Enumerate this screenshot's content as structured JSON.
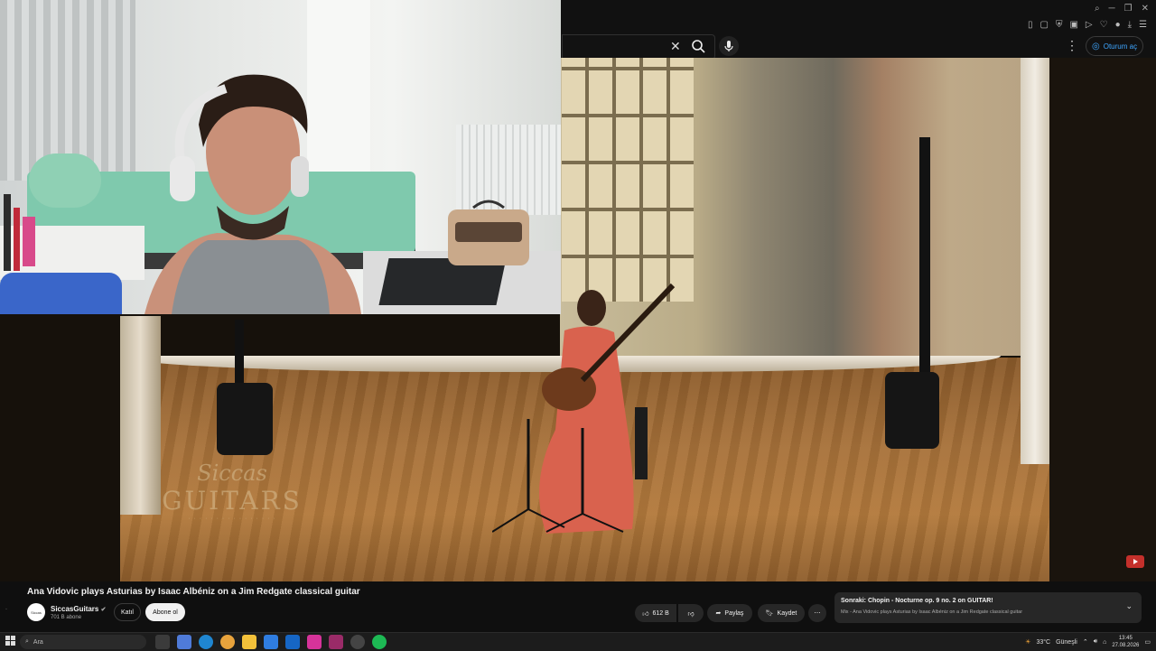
{
  "header": {
    "search_clear_icon": "close-icon",
    "search_icon": "search-icon",
    "mic_icon": "microphone-icon",
    "more_icon": "more-vert-icon",
    "signin_label": "Oturum aç"
  },
  "video": {
    "watermark_script": "Siccas",
    "watermark_main": "GUITARS"
  },
  "info": {
    "title": "Ana Vidovic plays Asturias by Isaac Albéniz on a Jim Redgate classical guitar",
    "channel_name": "SiccasGuitars",
    "channel_verified": true,
    "subscriber_count": "701 B abone",
    "join_label": "Katıl",
    "subscribe_label": "Abone ol",
    "like_count": "612 B",
    "share_label": "Paylaş",
    "save_label": "Kaydet"
  },
  "upnext": {
    "title": "Sonraki: Chopin - Nocturne op. 9 no. 2 on GUITAR!",
    "subtitle": "Mix - Ana Vidovic plays Asturias by Isaac Albéniz on a Jim Redgate classical guitar"
  },
  "taskbar": {
    "search_placeholder": "Ara",
    "weather": "33°C",
    "weather_desc": "Güneşli",
    "time": "13:45",
    "date": "27.08.2026"
  },
  "colors": {
    "accent": "#3ea6ff",
    "background": "#0f0f0f",
    "subscribe_bg": "#f1f1f1"
  }
}
